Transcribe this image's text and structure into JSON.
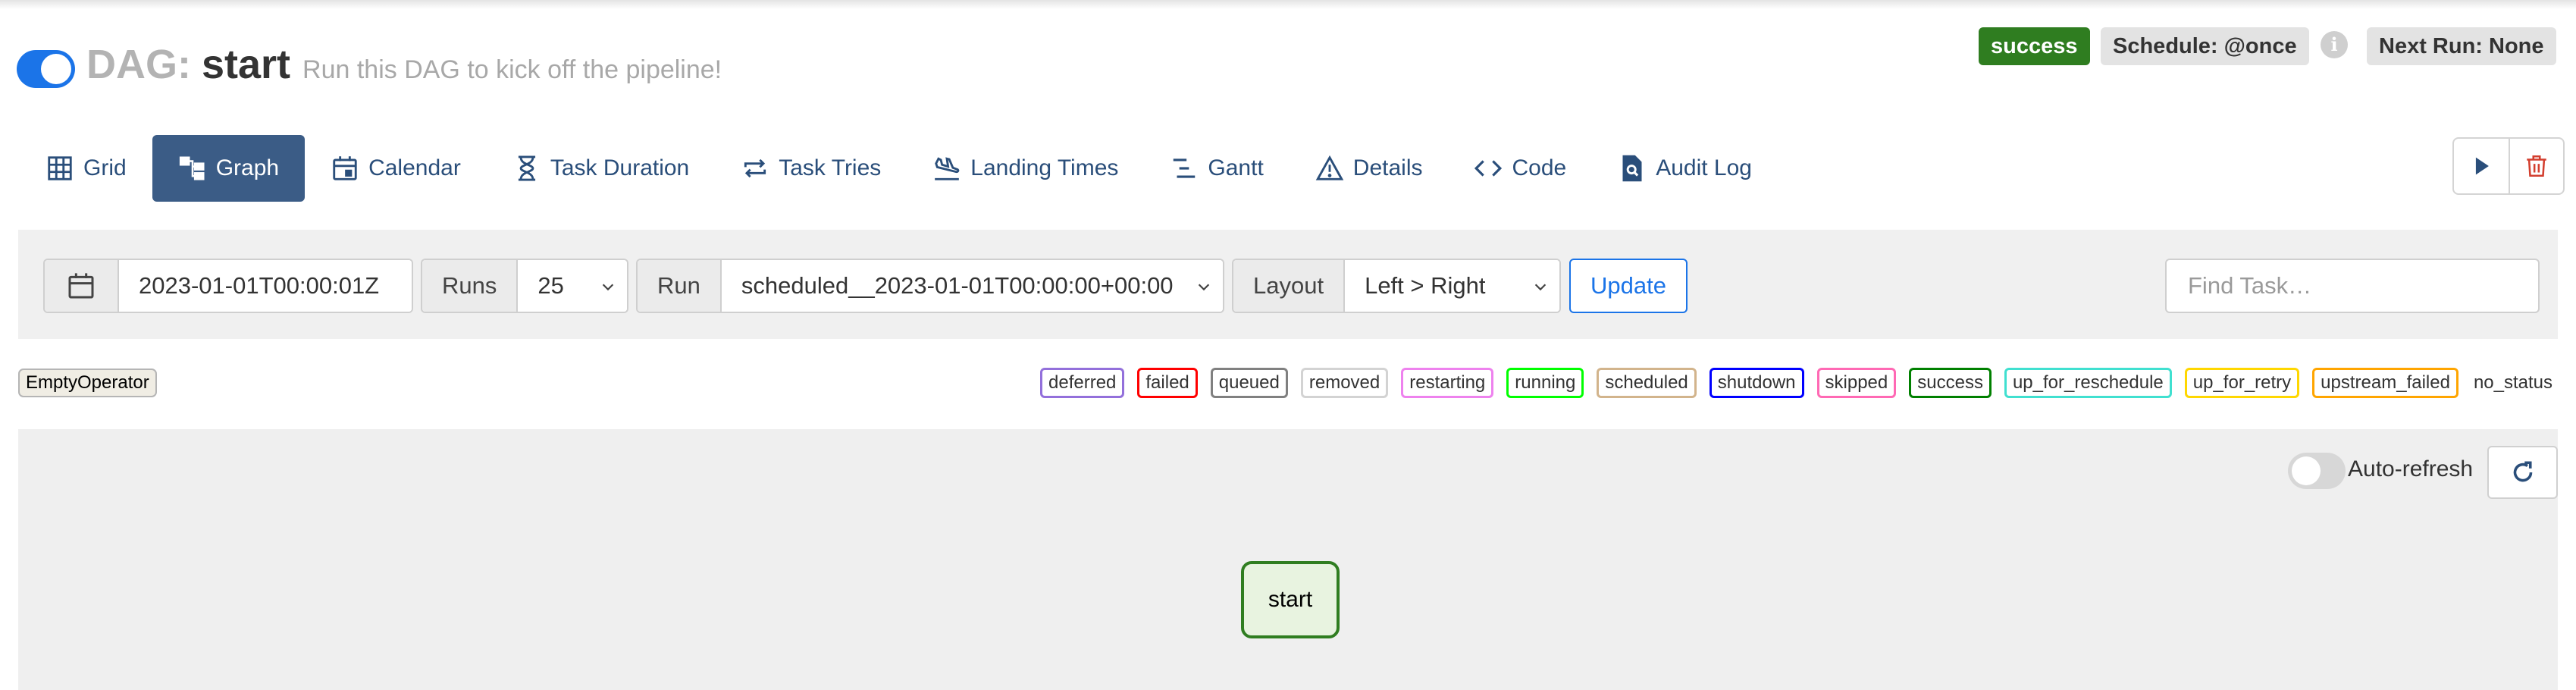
{
  "header": {
    "dag_prefix": "DAG:",
    "dag_id": "start",
    "description": "Run this DAG to kick off the pipeline!",
    "paused_toggle": "on",
    "status_badge": "success",
    "schedule_badge": "Schedule: @once",
    "next_run_badge": "Next Run: None"
  },
  "tabs": [
    {
      "label": "Grid",
      "icon": "grid-icon",
      "active": false
    },
    {
      "label": "Graph",
      "icon": "graph-icon",
      "active": true
    },
    {
      "label": "Calendar",
      "icon": "calendar-icon",
      "active": false
    },
    {
      "label": "Task Duration",
      "icon": "hourglass-icon",
      "active": false
    },
    {
      "label": "Task Tries",
      "icon": "retry-icon",
      "active": false
    },
    {
      "label": "Landing Times",
      "icon": "plane-landing-icon",
      "active": false
    },
    {
      "label": "Gantt",
      "icon": "gantt-icon",
      "active": false
    },
    {
      "label": "Details",
      "icon": "warning-triangle-icon",
      "active": false
    },
    {
      "label": "Code",
      "icon": "code-icon",
      "active": false
    },
    {
      "label": "Audit Log",
      "icon": "file-search-icon",
      "active": false
    }
  ],
  "actions": {
    "trigger_icon": "play-icon",
    "delete_icon": "trash-icon"
  },
  "filters": {
    "base_date": "2023-01-01T00:00:01Z",
    "runs_label": "Runs",
    "runs_value": "25",
    "run_label": "Run",
    "run_value": "scheduled__2023-01-01T00:00:00+00:00",
    "layout_label": "Layout",
    "layout_value": "Left > Right",
    "update_label": "Update",
    "find_task_placeholder": "Find Task…"
  },
  "legend": {
    "operator": "EmptyOperator",
    "operator_color": "#f0ede4",
    "states": [
      {
        "label": "deferred",
        "color": "#9370db"
      },
      {
        "label": "failed",
        "color": "#ff0000"
      },
      {
        "label": "queued",
        "color": "#808080"
      },
      {
        "label": "removed",
        "color": "#d3d3d3"
      },
      {
        "label": "restarting",
        "color": "#ee82ee"
      },
      {
        "label": "running",
        "color": "#00ff00"
      },
      {
        "label": "scheduled",
        "color": "#d2b48c"
      },
      {
        "label": "shutdown",
        "color": "#0000ff"
      },
      {
        "label": "skipped",
        "color": "#ff69b4"
      },
      {
        "label": "success",
        "color": "#008000"
      },
      {
        "label": "up_for_reschedule",
        "color": "#40e0d0"
      },
      {
        "label": "up_for_retry",
        "color": "#ffd700"
      },
      {
        "label": "upstream_failed",
        "color": "#ffa500"
      },
      {
        "label": "no_status",
        "color": ""
      }
    ]
  },
  "graph": {
    "auto_refresh_label": "Auto-refresh",
    "auto_refresh": "off",
    "nodes": [
      {
        "label": "start",
        "state": "success"
      }
    ]
  },
  "colors": {
    "accent": "#1b74e8",
    "active_tab": "#3b5c86",
    "success": "#2f7d20"
  }
}
